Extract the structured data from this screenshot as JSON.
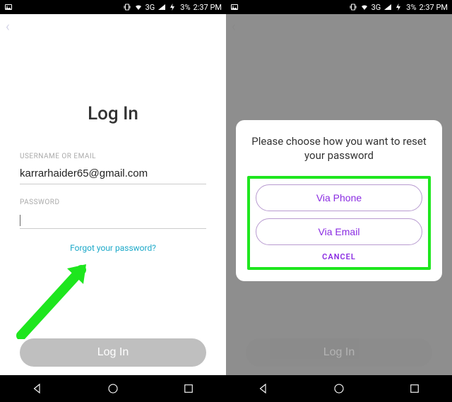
{
  "statusbar": {
    "network": "3G",
    "battery": "3%",
    "time": "2:37 PM"
  },
  "login": {
    "title": "Log In",
    "username_label": "USERNAME OR EMAIL",
    "username_value": "karrarhaider65@gmail.com",
    "password_label": "PASSWORD",
    "password_value": "",
    "forgot": "Forgot your password?",
    "button": "Log In"
  },
  "dialog": {
    "message": "Please choose how you want to reset your password",
    "via_phone": "Via Phone",
    "via_email": "Via Email",
    "cancel": "CANCEL"
  }
}
